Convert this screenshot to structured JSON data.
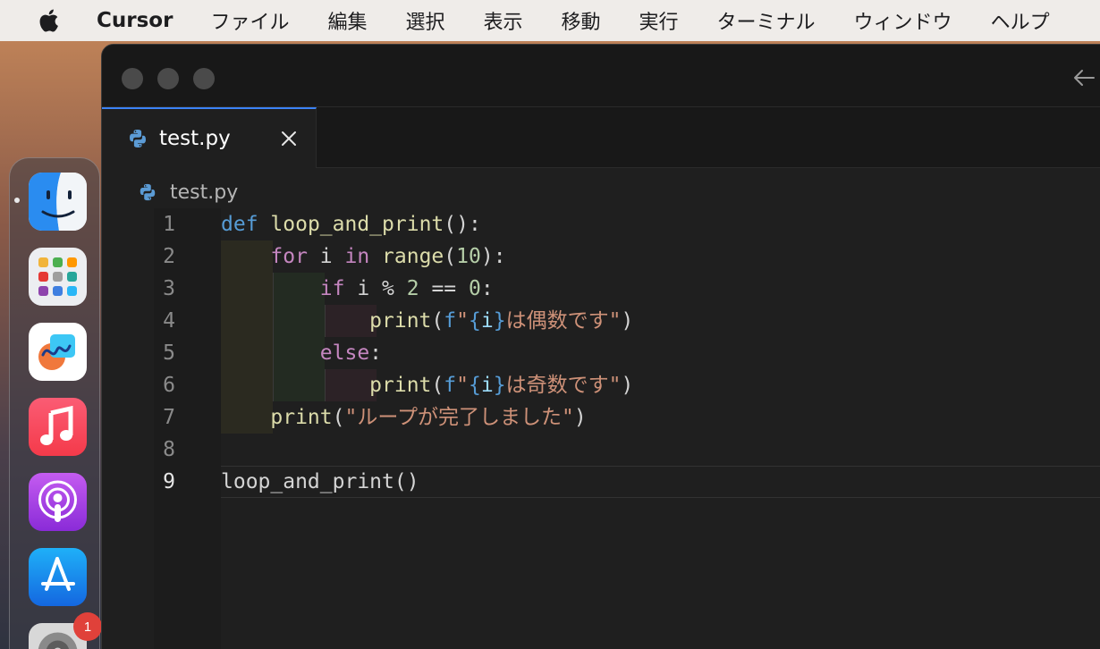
{
  "menubar": {
    "app_name": "Cursor",
    "items": [
      "ファイル",
      "編集",
      "選択",
      "表示",
      "移動",
      "実行",
      "ターミナル",
      "ウィンドウ",
      "ヘルプ"
    ]
  },
  "dock": {
    "apps": [
      {
        "name": "Finder",
        "icon": "finder-icon"
      },
      {
        "name": "Launchpad",
        "icon": "launchpad-icon"
      },
      {
        "name": "Freeform",
        "icon": "freeform-icon"
      },
      {
        "name": "Music",
        "icon": "music-icon"
      },
      {
        "name": "Podcasts",
        "icon": "podcasts-icon"
      },
      {
        "name": "App Store",
        "icon": "app-store-icon"
      },
      {
        "name": "System Settings",
        "icon": "settings-icon"
      }
    ],
    "settings_badge": "1"
  },
  "editor": {
    "tab_label": "test.py",
    "breadcrumb": "test.py",
    "active_line": 9,
    "line_numbers": [
      "1",
      "2",
      "3",
      "4",
      "5",
      "6",
      "7",
      "8",
      "9"
    ],
    "lines": {
      "l1": {
        "def": "def",
        "fname": "loop_and_print",
        "rest": "():"
      },
      "l2": {
        "for": "for",
        "i": " i ",
        "in": "in",
        "range": "range",
        "open": "(",
        "num": "10",
        "close": "):"
      },
      "l3": {
        "if": "if",
        "mid": " i % ",
        "n2": "2",
        "eq": " == ",
        "n0": "0",
        "colon": ":"
      },
      "l4": {
        "print": "print",
        "open": "(",
        "f": "f",
        "q": "\"",
        "lb": "{",
        "i": "i",
        "rb": "}",
        "text": "は偶数です\"",
        "close": ")"
      },
      "l5": {
        "else": "else",
        "colon": ":"
      },
      "l6": {
        "print": "print",
        "open": "(",
        "f": "f",
        "q": "\"",
        "lb": "{",
        "i": "i",
        "rb": "}",
        "text": "は奇数です\"",
        "close": ")"
      },
      "l7": {
        "print": "print",
        "open": "(",
        "str": "\"ループが完了しました\"",
        "close": ")"
      },
      "l9": {
        "call": "loop_and_print()"
      }
    }
  }
}
